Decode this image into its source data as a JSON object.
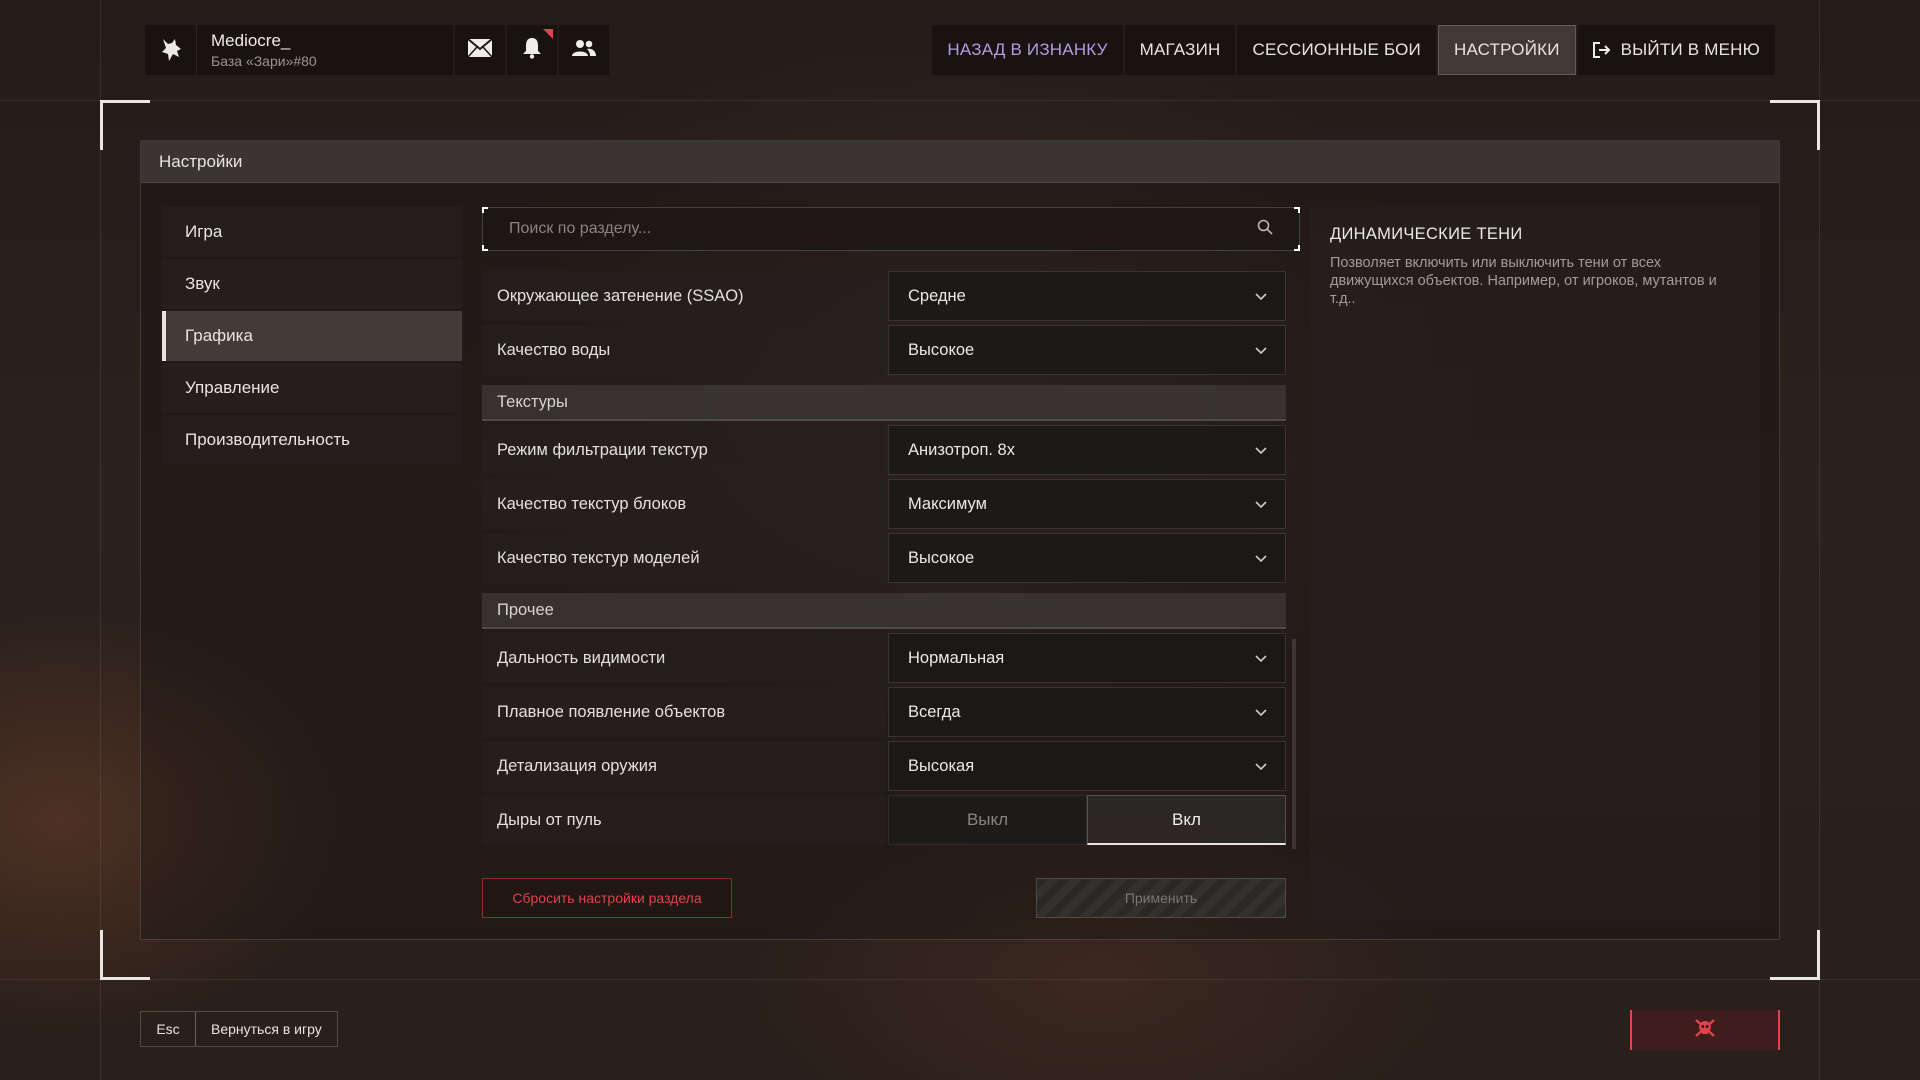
{
  "profile": {
    "name": "Mediocre_",
    "subtitle": "База «Зари»#80",
    "icons": [
      "wolf-logo-icon",
      "mail-icon",
      "bell-icon",
      "friends-icon"
    ]
  },
  "nav": {
    "back": "НАЗАД В ИЗНАНКУ",
    "shop": "МАГАЗИН",
    "sessions": "СЕССИОННЫЕ БОИ",
    "settings": "НАСТРОЙКИ",
    "exit": "ВЫЙТИ В МЕНЮ"
  },
  "panel": {
    "title": "Настройки"
  },
  "sidebar": {
    "items": [
      {
        "label": "Игра",
        "active": false
      },
      {
        "label": "Звук",
        "active": false
      },
      {
        "label": "Графика",
        "active": true
      },
      {
        "label": "Управление",
        "active": false
      },
      {
        "label": "Производительность",
        "active": false
      }
    ]
  },
  "search": {
    "placeholder": "Поиск по разделу..."
  },
  "settings": {
    "ssao": {
      "label": "Окружающее затенение (SSAO)",
      "value": "Средне"
    },
    "water": {
      "label": "Качество воды",
      "value": "Высокое"
    },
    "textures_section": "Текстуры",
    "filter": {
      "label": "Режим фильтрации текстур",
      "value": "Анизотроп. 8x"
    },
    "block_tex": {
      "label": "Качество текстур блоков",
      "value": "Максимум"
    },
    "model_tex": {
      "label": "Качество текстур моделей",
      "value": "Высокое"
    },
    "other_section": "Прочее",
    "view_dist": {
      "label": "Дальность видимости",
      "value": "Нормальная"
    },
    "fade_in": {
      "label": "Плавное появление объектов",
      "value": "Всегда"
    },
    "weapon_detail": {
      "label": "Детализация оружия",
      "value": "Высокая"
    },
    "bullet_holes": {
      "label": "Дыры от пуль",
      "off": "Выкл",
      "on": "Вкл",
      "selected": "on"
    }
  },
  "actions": {
    "reset": "Сбросить настройки раздела",
    "apply": "Применить"
  },
  "info": {
    "title": "ДИНАМИЧЕСКИЕ ТЕНИ",
    "description": "Позволяет включить или выключить тени от всех движущихся объектов. Например, от игроков, мутантов и т.д.."
  },
  "footer": {
    "key": "Esc",
    "label": "Вернуться в игру",
    "danger_icon": "skull-crossbones-icon"
  },
  "colors": {
    "accent_purple": "#b59ae0",
    "danger_red": "#e0434b",
    "text": "#e8e4e0"
  }
}
